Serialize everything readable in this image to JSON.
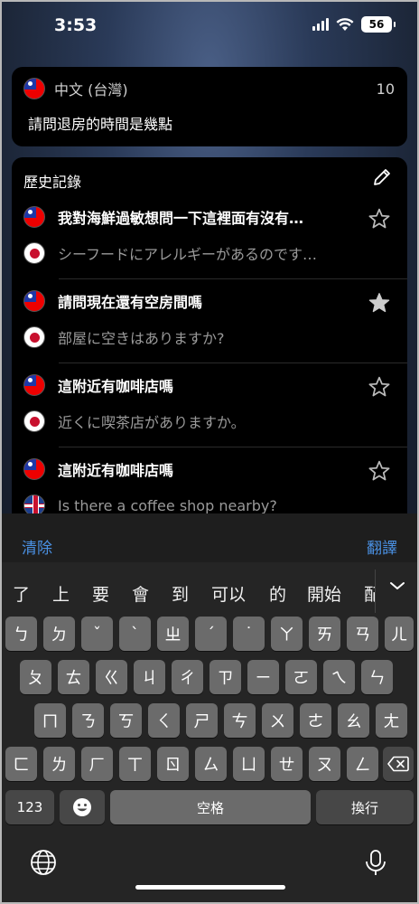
{
  "status": {
    "time": "3:53",
    "battery": "56"
  },
  "source": {
    "language": "中文 (台灣)",
    "count": "10",
    "text": "請問退房的時間是幾點"
  },
  "history": {
    "title": "歷史記錄",
    "entries": [
      {
        "source_flag": "taiwan-flag-icon",
        "source": "我對海鮮過敏想問一下這裡面有沒有…",
        "target_flag": "japan-flag-icon",
        "target": "シーフードにアレルギーがあるのです…",
        "starred": false
      },
      {
        "source_flag": "taiwan-flag-icon",
        "source": "請問現在還有空房間嗎",
        "target_flag": "japan-flag-icon",
        "target": "部屋に空きはありますか?",
        "starred": true
      },
      {
        "source_flag": "taiwan-flag-icon",
        "source": "這附近有咖啡店嗎",
        "target_flag": "japan-flag-icon",
        "target": "近くに喫茶店がありますか。",
        "starred": false
      },
      {
        "source_flag": "taiwan-flag-icon",
        "source": "這附近有咖啡店嗎",
        "target_flag": "uk-flag-icon",
        "target": "Is there a coffee shop nearby?",
        "starred": false
      }
    ]
  },
  "actions": {
    "clear": "清除",
    "translate": "翻譯"
  },
  "suggestions": [
    "了",
    "上",
    "要",
    "會",
    "到",
    "可以",
    "的",
    "開始",
    "配"
  ],
  "keyboard": {
    "row1": [
      "ㄅ",
      "ㄉ",
      "ˇ",
      "ˋ",
      "ㄓ",
      "ˊ",
      "˙",
      "ㄚ",
      "ㄞ",
      "ㄢ",
      "ㄦ"
    ],
    "row2": [
      "ㄆ",
      "ㄊ",
      "ㄍ",
      "ㄐ",
      "ㄔ",
      "ㄗ",
      "ㄧ",
      "ㄛ",
      "ㄟ",
      "ㄣ"
    ],
    "row3": [
      "ㄇ",
      "ㄋ",
      "ㄎ",
      "ㄑ",
      "ㄕ",
      "ㄘ",
      "ㄨ",
      "ㄜ",
      "ㄠ",
      "ㄤ"
    ],
    "row4": [
      "ㄈ",
      "ㄌ",
      "ㄏ",
      "ㄒ",
      "ㄖ",
      "ㄙ",
      "ㄩ",
      "ㄝ",
      "ㄡ",
      "ㄥ"
    ],
    "numbers_key": "123",
    "space_key": "空格",
    "return_key": "換行"
  }
}
